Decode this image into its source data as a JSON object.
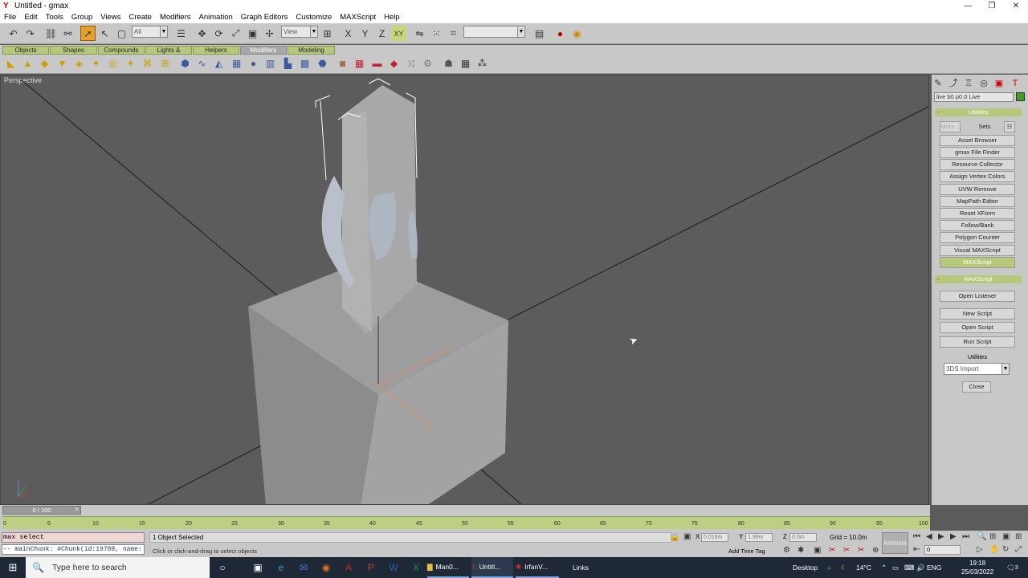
{
  "window": {
    "title": "Untitled - gmax",
    "app_icon": "gmax-logo-icon",
    "controls": [
      "—",
      "❐",
      "✕"
    ]
  },
  "menu": [
    "File",
    "Edit",
    "Tools",
    "Group",
    "Views",
    "Create",
    "Modifiers",
    "Animation",
    "Graph Editors",
    "Customize",
    "MAXScript",
    "Help"
  ],
  "toolbar": {
    "selection_filter": "All",
    "ref_coord": "View",
    "named_sets": ""
  },
  "tabs": [
    {
      "label": "Objects",
      "selected": false
    },
    {
      "label": "Shapes",
      "selected": false
    },
    {
      "label": "Compounds",
      "selected": false
    },
    {
      "label": "Lights & Cameras",
      "selected": false
    },
    {
      "label": "Helpers",
      "selected": false
    },
    {
      "label": "Modifiers",
      "selected": true
    },
    {
      "label": "Modeling",
      "selected": false
    }
  ],
  "viewport": {
    "label": "Perspective"
  },
  "command_panel": {
    "object_name": "live b0 p0.0 Live",
    "object_color": "#4a9a2a",
    "utilities_rollout": "Utilities",
    "more_label": "More...",
    "sets_label": "Sets",
    "utility_buttons": [
      {
        "label": "Asset Browser",
        "highlight": false
      },
      {
        "label": "gmax File Finder",
        "highlight": false
      },
      {
        "label": "Resource Collector",
        "highlight": false
      },
      {
        "label": "Assign Vertex Colors",
        "highlight": false
      },
      {
        "label": "UVW Remove",
        "highlight": false
      },
      {
        "label": "MapPath Editor",
        "highlight": false
      },
      {
        "label": "Reset XForm",
        "highlight": false
      },
      {
        "label": "Follow/Bank",
        "highlight": false
      },
      {
        "label": "Polygon Counter",
        "highlight": false
      },
      {
        "label": "Visual MAXScript",
        "highlight": false
      },
      {
        "label": "MAXScript",
        "highlight": true
      }
    ],
    "maxscript_rollout": "MAXScript",
    "open_listener": "Open Listener",
    "new_script": "New Script",
    "open_script": "Open Script",
    "run_script": "Run Script",
    "utilities_label": "Utilities",
    "utilities_select": "3DS Import",
    "close": "Close"
  },
  "timeline": {
    "slider": "0 / 100",
    "ticks": [
      "0",
      "5",
      "10",
      "15",
      "20",
      "25",
      "30",
      "35",
      "40",
      "45",
      "50",
      "55",
      "60",
      "65",
      "70",
      "75",
      "80",
      "85",
      "90",
      "95",
      "100"
    ]
  },
  "status": {
    "listener_line1": "max select",
    "listener_line2": "-- mainChunk: #Chunk(id:19789, name:",
    "selected": "1 Object Selected",
    "prompt": "Click or click-and-drag to select objects",
    "x_label": "X",
    "x_value": "0.016m",
    "y_label": "Y",
    "y_value": "1.99m",
    "z_label": "Z",
    "z_value": "0.0m",
    "grid": "Grid = 10.0m",
    "add_time_tag": "Add Time Tag",
    "animate": "Animate",
    "frame": "0"
  },
  "taskbar": {
    "search_placeholder": "Type here to search",
    "tasks": [
      "Man0...",
      "Untitl...",
      "IrfanV..."
    ],
    "links": "Links",
    "desktop": "Desktop",
    "temp": "14°C",
    "lang": "ENG",
    "time": "19:18",
    "date": "25/03/2022",
    "notif": "3"
  }
}
